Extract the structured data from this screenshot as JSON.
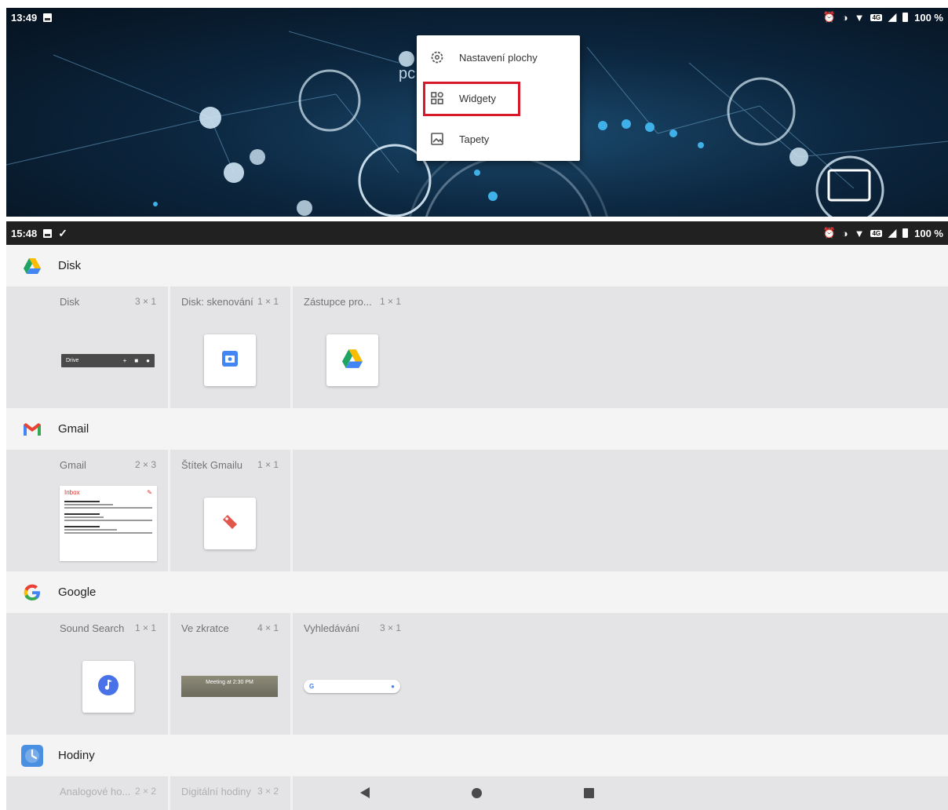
{
  "home": {
    "status_time": "13:49",
    "battery": "100 %",
    "menu": {
      "items": [
        {
          "label": "Nastavení plochy",
          "icon": "gear-icon"
        },
        {
          "label": "Widgety",
          "icon": "widgets-icon",
          "highlighted": true
        },
        {
          "label": "Tapety",
          "icon": "wallpaper-icon"
        }
      ]
    },
    "highlight_color": "#d7192a"
  },
  "picker": {
    "status_time": "15:48",
    "battery": "100 %",
    "apps": [
      {
        "name": "Disk",
        "icon": "google-drive-icon",
        "widgets": [
          {
            "title": "Disk",
            "size": "3 × 1",
            "preview_text": "Drive"
          },
          {
            "title": "Disk: skenování",
            "size": "1 × 1"
          },
          {
            "title": "Zástupce pro...",
            "size": "1 × 1"
          }
        ]
      },
      {
        "name": "Gmail",
        "icon": "gmail-icon",
        "widgets": [
          {
            "title": "Gmail",
            "size": "2 × 3",
            "preview_text": "Inbox"
          },
          {
            "title": "Štítek Gmailu",
            "size": "1 × 1"
          }
        ]
      },
      {
        "name": "Google",
        "icon": "google-icon",
        "widgets": [
          {
            "title": "Sound Search",
            "size": "1 × 1"
          },
          {
            "title": "Ve zkratce",
            "size": "4 × 1",
            "preview_text": "Meeting at 2:30 PM"
          },
          {
            "title": "Vyhledávání",
            "size": "3 × 1",
            "preview_text": "G"
          }
        ]
      },
      {
        "name": "Hodiny",
        "icon": "clock-icon",
        "widgets": [
          {
            "title": "Analogové ho...",
            "size": "2 × 2"
          },
          {
            "title": "Digitální hodiny",
            "size": "3 × 2"
          }
        ]
      }
    ]
  }
}
